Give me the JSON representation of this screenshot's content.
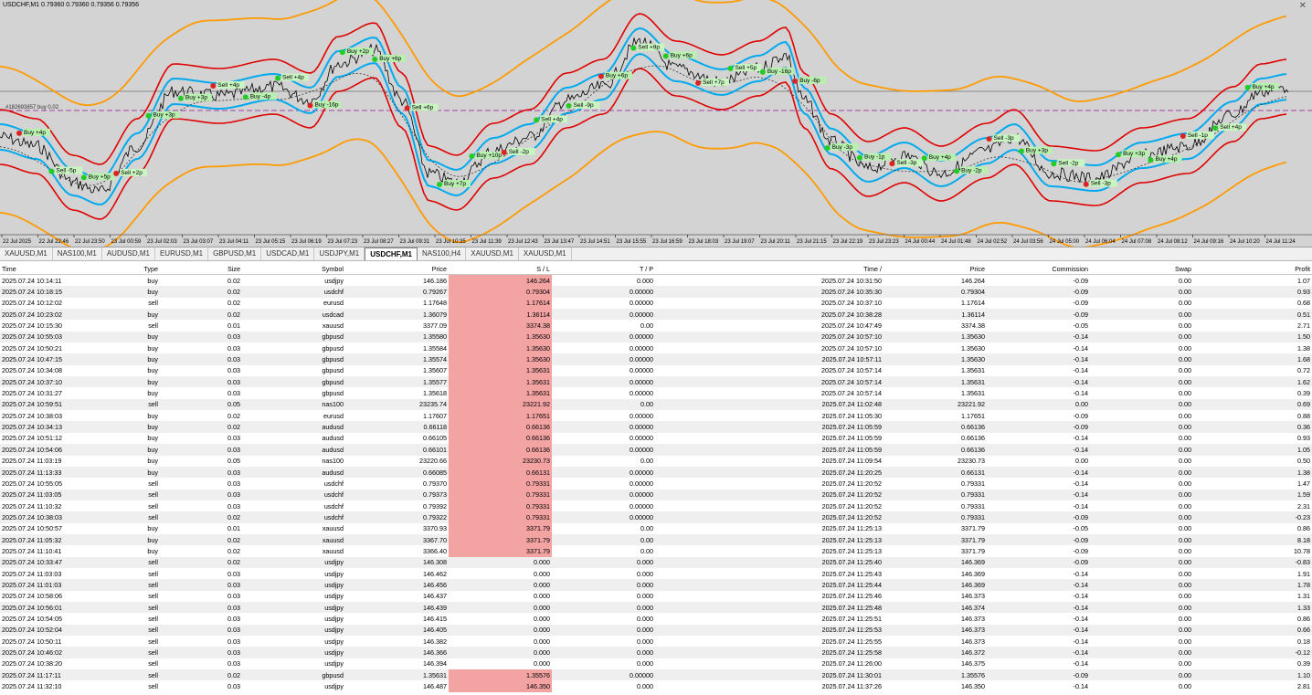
{
  "chart": {
    "title": "USDCHF,M1  0.79360 0.79360 0.79356 0.79356",
    "order_line_label": "#182693857 buy 0.02",
    "x_ticks": [
      "22 Jul 2025",
      "22 Jul 22:46",
      "22 Jul 23:50",
      "23 Jul 00:59",
      "23 Jul 02:03",
      "23 Jul 03:07",
      "23 Jul 04:11",
      "23 Jul 05:15",
      "23 Jul 06:19",
      "23 Jul 07:23",
      "23 Jul 08:27",
      "23 Jul 09:31",
      "23 Jul 10:35",
      "23 Jul 11:39",
      "23 Jul 12:43",
      "23 Jul 13:47",
      "23 Jul 14:51",
      "23 Jul 15:55",
      "23 Jul 16:59",
      "23 Jul 18:03",
      "23 Jul 19:07",
      "23 Jul 20:11",
      "23 Jul 21:15",
      "23 Jul 22:19",
      "23 Jul 23:23",
      "24 Jul 00:44",
      "24 Jul 01:48",
      "24 Jul 02:52",
      "24 Jul 03:56",
      "24 Jul 05:00",
      "24 Jul 06:04",
      "24 Jul 07:08",
      "24 Jul 08:12",
      "24 Jul 09:16",
      "24 Jul 10:20",
      "24 Jul 11:24"
    ],
    "trade_labels": [
      "Buy +4p",
      "Sell -5p",
      "Buy +5p",
      "Sell +2p",
      "Buy +3p",
      "Buy +3p",
      "Sell +4p",
      "Buy -4p",
      "Sell +4p",
      "Buy -16p",
      "Buy +2p",
      "Buy +6p",
      "Sell +6p",
      "Buy +7p",
      "Buy +10p",
      "Sell -2p",
      "Sell +4p",
      "Sell -9p",
      "Buy +6p",
      "Sell +9p",
      "Buy +6p",
      "Sell +7p",
      "Sell +5p",
      "Buy -16p",
      "Buy -6p",
      "Buy -3p",
      "Buy -1p",
      "Sell -3p",
      "Buy +4p",
      "Buy -2p",
      "Sell -3p",
      "Buy +3p",
      "Sell -2p",
      "Sell -3p",
      "Buy +3p",
      "Buy +4p",
      "Sell -1p",
      "Sell +4p",
      "Buy +4p"
    ],
    "colors": {
      "bg": "#d3d3d3",
      "outer_band": "#ff9a00",
      "red_band": "#e00000",
      "blue_band": "#00aaee",
      "price": "#000000"
    }
  },
  "tabs": [
    {
      "label": "XAUUSD,M1",
      "active": false
    },
    {
      "label": "NAS100,M1",
      "active": false
    },
    {
      "label": "AUDUSD,M1",
      "active": false
    },
    {
      "label": "EURUSD,M1",
      "active": false
    },
    {
      "label": "GBPUSD,M1",
      "active": false
    },
    {
      "label": "USDCAD,M1",
      "active": false
    },
    {
      "label": "USDJPY,M1",
      "active": false
    },
    {
      "label": "USDCHF,M1",
      "active": true
    },
    {
      "label": "NAS100,H4",
      "active": false
    },
    {
      "label": "XAUUSD,M1",
      "active": false
    },
    {
      "label": "XAUUSD,M1",
      "active": false
    }
  ],
  "table": {
    "columns": [
      "Time",
      "Type",
      "Size",
      "Symbol",
      "Price",
      "S / L",
      "T / P",
      "Time  /",
      "Price",
      "Commission",
      "Swap",
      "Profit"
    ],
    "rows": [
      [
        "2025.07.24 10:14:11",
        "buy",
        "0.02",
        "usdjpy",
        "146.186",
        "146.264",
        "0.000",
        "2025.07.24 10:31:50",
        "146.264",
        "-0.09",
        "0.00",
        "1.07"
      ],
      [
        "2025.07.24 10:18:15",
        "buy",
        "0.02",
        "usdchf",
        "0.79267",
        "0.79304",
        "0.00000",
        "2025.07.24 10:35:30",
        "0.79304",
        "-0.09",
        "0.00",
        "0.93"
      ],
      [
        "2025.07.24 10:12:02",
        "sell",
        "0.02",
        "eurusd",
        "1.17648",
        "1.17614",
        "0.00000",
        "2025.07.24 10:37:10",
        "1.17614",
        "-0.09",
        "0.00",
        "0.68"
      ],
      [
        "2025.07.24 10:23:02",
        "buy",
        "0.02",
        "usdcad",
        "1.36079",
        "1.36114",
        "0.00000",
        "2025.07.24 10:38:28",
        "1.36114",
        "-0.09",
        "0.00",
        "0.51"
      ],
      [
        "2025.07.24 10:15:30",
        "sell",
        "0.01",
        "xauusd",
        "3377.09",
        "3374.38",
        "0.00",
        "2025.07.24 10:47:49",
        "3374.38",
        "-0.05",
        "0.00",
        "2.71"
      ],
      [
        "2025.07.24 10:55:03",
        "buy",
        "0.03",
        "gbpusd",
        "1.35580",
        "1.35630",
        "0.00000",
        "2025.07.24 10:57:10",
        "1.35630",
        "-0.14",
        "0.00",
        "1.50"
      ],
      [
        "2025.07.24 10:50:21",
        "buy",
        "0.03",
        "gbpusd",
        "1.35584",
        "1.35630",
        "0.00000",
        "2025.07.24 10:57:10",
        "1.35630",
        "-0.14",
        "0.00",
        "1.38"
      ],
      [
        "2025.07.24 10:47:15",
        "buy",
        "0.03",
        "gbpusd",
        "1.35574",
        "1.35630",
        "0.00000",
        "2025.07.24 10:57:11",
        "1.35630",
        "-0.14",
        "0.00",
        "1.68"
      ],
      [
        "2025.07.24 10:34:08",
        "buy",
        "0.03",
        "gbpusd",
        "1.35607",
        "1.35631",
        "0.00000",
        "2025.07.24 10:57:14",
        "1.35631",
        "-0.14",
        "0.00",
        "0.72"
      ],
      [
        "2025.07.24 10:37:10",
        "buy",
        "0.03",
        "gbpusd",
        "1.35577",
        "1.35631",
        "0.00000",
        "2025.07.24 10:57:14",
        "1.35631",
        "-0.14",
        "0.00",
        "1.62"
      ],
      [
        "2025.07.24 10:31:27",
        "buy",
        "0.03",
        "gbpusd",
        "1.35618",
        "1.35631",
        "0.00000",
        "2025.07.24 10:57:14",
        "1.35631",
        "-0.14",
        "0.00",
        "0.39"
      ],
      [
        "2025.07.24 10:59:51",
        "sell",
        "0.05",
        "nas100",
        "23235.74",
        "23221.92",
        "0.00",
        "2025.07.24 11:02:48",
        "23221.92",
        "0.00",
        "0.00",
        "0.69"
      ],
      [
        "2025.07.24 10:38:03",
        "buy",
        "0.02",
        "eurusd",
        "1.17607",
        "1.17651",
        "0.00000",
        "2025.07.24 11:05:30",
        "1.17651",
        "-0.09",
        "0.00",
        "0.88"
      ],
      [
        "2025.07.24 10:34:13",
        "buy",
        "0.02",
        "audusd",
        "0.66118",
        "0.66136",
        "0.00000",
        "2025.07.24 11:05:59",
        "0.66136",
        "-0.09",
        "0.00",
        "0.36"
      ],
      [
        "2025.07.24 10:51:12",
        "buy",
        "0.03",
        "audusd",
        "0.66105",
        "0.66136",
        "0.00000",
        "2025.07.24 11:05:59",
        "0.66136",
        "-0.14",
        "0.00",
        "0.93"
      ],
      [
        "2025.07.24 10:54:06",
        "buy",
        "0.03",
        "audusd",
        "0.66101",
        "0.66136",
        "0.00000",
        "2025.07.24 11:05:59",
        "0.66136",
        "-0.14",
        "0.00",
        "1.05"
      ],
      [
        "2025.07.24 11:03:19",
        "buy",
        "0.05",
        "nas100",
        "23220.66",
        "23230.73",
        "0.00",
        "2025.07.24 11:09:54",
        "23230.73",
        "0.00",
        "0.00",
        "0.50"
      ],
      [
        "2025.07.24 11:13:33",
        "buy",
        "0.03",
        "audusd",
        "0.66085",
        "0.66131",
        "0.00000",
        "2025.07.24 11:20:25",
        "0.66131",
        "-0.14",
        "0.00",
        "1.38"
      ],
      [
        "2025.07.24 10:55:05",
        "sell",
        "0.03",
        "usdchf",
        "0.79370",
        "0.79331",
        "0.00000",
        "2025.07.24 11:20:52",
        "0.79331",
        "-0.14",
        "0.00",
        "1.47"
      ],
      [
        "2025.07.24 11:03:05",
        "sell",
        "0.03",
        "usdchf",
        "0.79373",
        "0.79331",
        "0.00000",
        "2025.07.24 11:20:52",
        "0.79331",
        "-0.14",
        "0.00",
        "1.59"
      ],
      [
        "2025.07.24 11:10:32",
        "sell",
        "0.03",
        "usdchf",
        "0.79392",
        "0.79331",
        "0.00000",
        "2025.07.24 11:20:52",
        "0.79331",
        "-0.14",
        "0.00",
        "2.31"
      ],
      [
        "2025.07.24 10:38:03",
        "sell",
        "0.02",
        "usdchf",
        "0.79322",
        "0.79331",
        "0.00000",
        "2025.07.24 11:20:52",
        "0.79331",
        "-0.09",
        "0.00",
        "-0.23"
      ],
      [
        "2025.07.24 10:50:57",
        "buy",
        "0.01",
        "xauusd",
        "3370.93",
        "3371.79",
        "0.00",
        "2025.07.24 11:25:13",
        "3371.79",
        "-0.05",
        "0.00",
        "0.86"
      ],
      [
        "2025.07.24 11:05:32",
        "buy",
        "0.02",
        "xauusd",
        "3367.70",
        "3371.79",
        "0.00",
        "2025.07.24 11:25:13",
        "3371.79",
        "-0.09",
        "0.00",
        "8.18"
      ],
      [
        "2025.07.24 11:10:41",
        "buy",
        "0.02",
        "xauusd",
        "3366.40",
        "3371.79",
        "0.00",
        "2025.07.24 11:25:13",
        "3371.79",
        "-0.09",
        "0.00",
        "10.78"
      ],
      [
        "2025.07.24 10:33:47",
        "sell",
        "0.02",
        "usdjpy",
        "146.308",
        "0.000",
        "0.000",
        "2025.07.24 11:25:40",
        "146.369",
        "-0.09",
        "0.00",
        "-0.83"
      ],
      [
        "2025.07.24 11:03:03",
        "sell",
        "0.03",
        "usdjpy",
        "146.462",
        "0.000",
        "0.000",
        "2025.07.24 11:25:43",
        "146.369",
        "-0.14",
        "0.00",
        "1.91"
      ],
      [
        "2025.07.24 11:01:03",
        "sell",
        "0.03",
        "usdjpy",
        "146.456",
        "0.000",
        "0.000",
        "2025.07.24 11:25:44",
        "146.369",
        "-0.14",
        "0.00",
        "1.78"
      ],
      [
        "2025.07.24 10:58:06",
        "sell",
        "0.03",
        "usdjpy",
        "146.437",
        "0.000",
        "0.000",
        "2025.07.24 11:25:46",
        "146.373",
        "-0.14",
        "0.00",
        "1.31"
      ],
      [
        "2025.07.24 10:56:01",
        "sell",
        "0.03",
        "usdjpy",
        "146.439",
        "0.000",
        "0.000",
        "2025.07.24 11:25:48",
        "146.374",
        "-0.14",
        "0.00",
        "1.33"
      ],
      [
        "2025.07.24 10:54:05",
        "sell",
        "0.03",
        "usdjpy",
        "146.415",
        "0.000",
        "0.000",
        "2025.07.24 11:25:51",
        "146.373",
        "-0.14",
        "0.00",
        "0.86"
      ],
      [
        "2025.07.24 10:52:04",
        "sell",
        "0.03",
        "usdjpy",
        "146.405",
        "0.000",
        "0.000",
        "2025.07.24 11:25:53",
        "146.373",
        "-0.14",
        "0.00",
        "0.66"
      ],
      [
        "2025.07.24 10:50:11",
        "sell",
        "0.03",
        "usdjpy",
        "146.382",
        "0.000",
        "0.000",
        "2025.07.24 11:25:55",
        "146.373",
        "-0.14",
        "0.00",
        "0.18"
      ],
      [
        "2025.07.24 10:46:02",
        "sell",
        "0.03",
        "usdjpy",
        "146.366",
        "0.000",
        "0.000",
        "2025.07.24 11:25:58",
        "146.372",
        "-0.14",
        "0.00",
        "-0.12"
      ],
      [
        "2025.07.24 10:38:20",
        "sell",
        "0.03",
        "usdjpy",
        "146.394",
        "0.000",
        "0.000",
        "2025.07.24 11:26:00",
        "146.375",
        "-0.14",
        "0.00",
        "0.39"
      ],
      [
        "2025.07.24 11:17:11",
        "sell",
        "0.02",
        "gbpusd",
        "1.35631",
        "1.35576",
        "0.00000",
        "2025.07.24 11:30:01",
        "1.35576",
        "-0.09",
        "0.00",
        "1.10"
      ],
      [
        "2025.07.24 11:32:10",
        "sell",
        "0.03",
        "usdjpy",
        "146.487",
        "146.350",
        "0.000",
        "2025.07.24 11:37:26",
        "146.350",
        "-0.14",
        "0.00",
        "2.81"
      ]
    ]
  }
}
